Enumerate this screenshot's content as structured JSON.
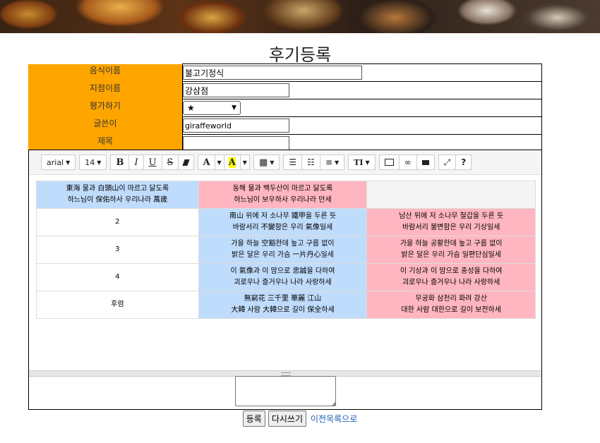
{
  "page": {
    "title": "후기등록"
  },
  "form": {
    "food_name": {
      "label": "음식이름",
      "value": "불고기정식"
    },
    "branch_name": {
      "label": "지점이름",
      "value": "강삼점"
    },
    "rating": {
      "label": "평가하기",
      "value": "★"
    },
    "author": {
      "label": "글쓴이",
      "value": "giraffeworld"
    },
    "subject": {
      "label": "제목",
      "value": ""
    }
  },
  "toolbar": {
    "font_family": "arial",
    "font_size": "14",
    "bold": "B",
    "italic": "I",
    "underline": "U",
    "strike": "S",
    "font_color": "A",
    "highlight": "A",
    "fontsize_tool": "TI",
    "help": "?"
  },
  "poem": {
    "rows": [
      {
        "c1": "東海 물과 白頭山이 마르고 닳도록\n하느님이 保佑하사 우리나라 萬歲",
        "c2": "동해 물과 백두산이 마르고 닳도록\n하느님이 보우하사 우리나라 만세",
        "c3": ""
      },
      {
        "c1": "2",
        "c2": "南山 위에 저 소나무 鐵甲을 두른 듯\n바람서리 不變함은 우리 氣像일세",
        "c3": "남산 위에 저 소나무 철갑을 두른 듯\n바람서리 불변함은 우리 기상일세"
      },
      {
        "c1": "3",
        "c2": "가을 하늘 空豁한데 높고 구름 없이\n밝은 달은 우리 가슴 一片丹心일세",
        "c3": "가을 하늘 공활한데 높고 구름 없이\n밝은 달은 우리 가슴 일편단심일세"
      },
      {
        "c1": "4",
        "c2": "이 氣像과 이 맘으로 忠誠을 다하여\n괴로우나 즐거우나 나라 사랑하세",
        "c3": "이 기상과 이 맘으로 충성을 다하여\n괴로우나 즐거우나 나라 사랑하세"
      },
      {
        "c1": "후렴",
        "c2": "無窮花 三千里 華麗 江山\n大韓 사람 大韓으로 길이 保全하세",
        "c3": "무궁화 삼천리 화려 강산\n대한 사람 대한으로 길이 보전하세"
      }
    ]
  },
  "actions": {
    "submit": "등록",
    "reset": "다시쓰기",
    "back": "이전목록으로"
  },
  "colors": {
    "label_bg": "#ffa500",
    "blue_cell": "#c0dcfc",
    "pink_cell": "#ffb6c1"
  }
}
